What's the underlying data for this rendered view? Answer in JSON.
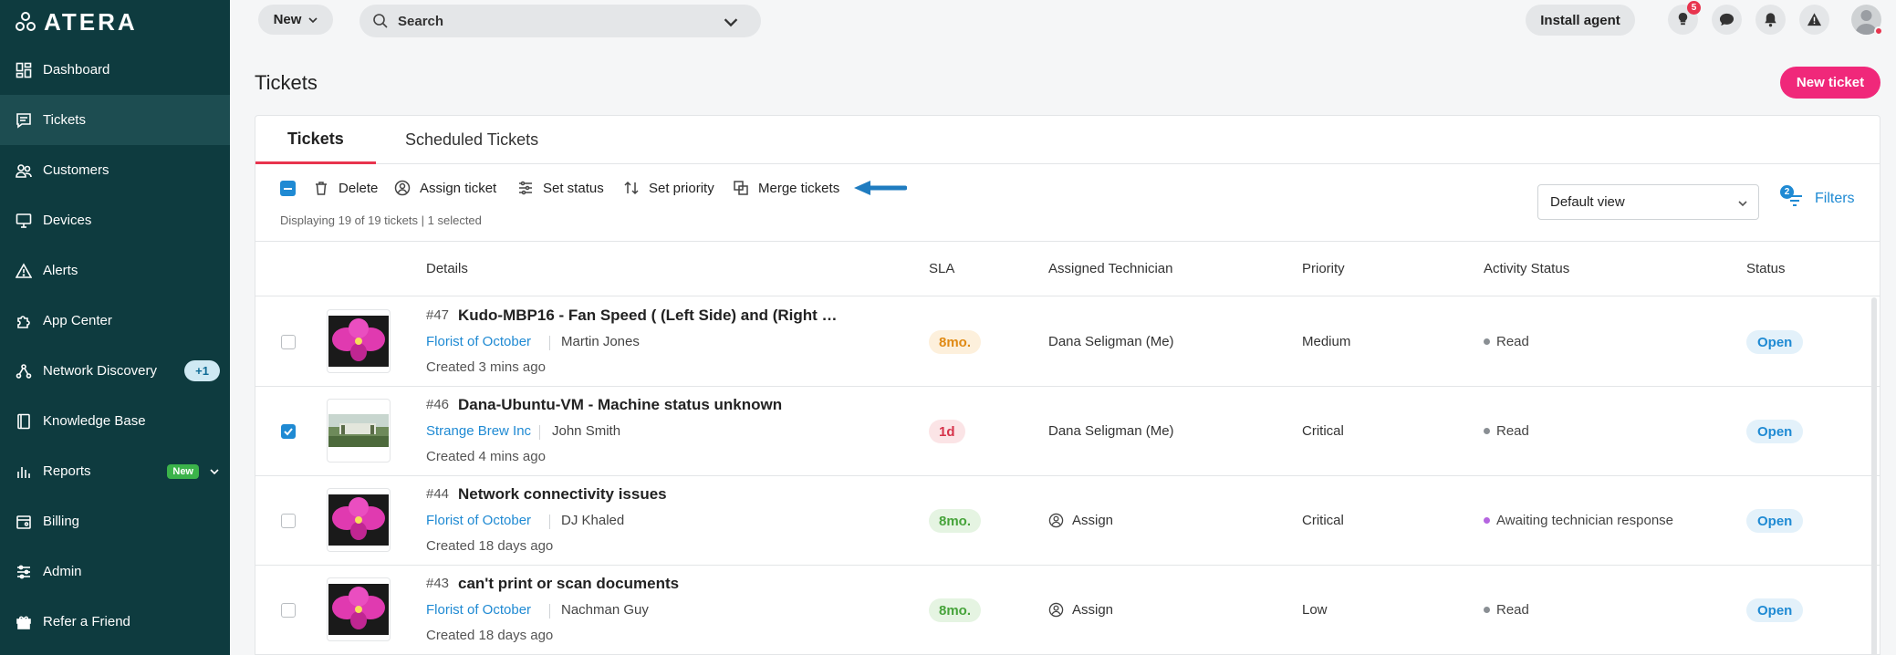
{
  "app": {
    "logo_text": "ATERA"
  },
  "sidebar": {
    "items": [
      {
        "label": "Dashboard",
        "icon": "dashboard-icon"
      },
      {
        "label": "Tickets",
        "icon": "tickets-icon",
        "active": true
      },
      {
        "label": "Customers",
        "icon": "customers-icon"
      },
      {
        "label": "Devices",
        "icon": "devices-icon"
      },
      {
        "label": "Alerts",
        "icon": "alerts-icon"
      },
      {
        "label": "App Center",
        "icon": "app-center-icon"
      },
      {
        "label": "Network Discovery",
        "icon": "network-discovery-icon",
        "count": "+1"
      },
      {
        "label": "Knowledge Base",
        "icon": "knowledge-base-icon"
      },
      {
        "label": "Reports",
        "icon": "reports-icon",
        "tag": "New"
      },
      {
        "label": "Billing",
        "icon": "billing-icon"
      },
      {
        "label": "Admin",
        "icon": "admin-icon"
      },
      {
        "label": "Refer a Friend",
        "icon": "gift-icon"
      }
    ]
  },
  "topbar": {
    "new_label": "New",
    "search_placeholder": "Search",
    "install_agent_label": "Install agent",
    "notification_badge": "5"
  },
  "page": {
    "title": "Tickets",
    "new_ticket_label": "New ticket"
  },
  "tabs": [
    {
      "label": "Tickets",
      "active": true
    },
    {
      "label": "Scheduled Tickets"
    }
  ],
  "toolbar": {
    "delete_label": "Delete",
    "assign_label": "Assign ticket",
    "set_status_label": "Set status",
    "set_priority_label": "Set priority",
    "merge_label": "Merge tickets",
    "display_count": "Displaying 19 of 19 tickets | 1 selected",
    "view_select": "Default view",
    "filters_label": "Filters",
    "filters_count": "2"
  },
  "table": {
    "columns": [
      "Details",
      "SLA",
      "Assigned Technician",
      "Priority",
      "Activity Status",
      "Status"
    ],
    "rows": [
      {
        "number": "#47",
        "title": "Kudo-MBP16 - Fan Speed ( (Left Side) and (Right …",
        "customer": "Florist of October",
        "contact": "Martin Jones",
        "created": "Created 3 mins ago",
        "sla": "8mo.",
        "sla_color": "orange",
        "technician": "Dana Seligman (Me)",
        "priority": "Medium",
        "activity": "Read",
        "activity_dot": "#8a8f94",
        "status": "Open",
        "checked": false,
        "thumb": "orchid"
      },
      {
        "number": "#46",
        "title": "Dana-Ubuntu-VM - Machine status unknown",
        "customer": "Strange Brew Inc",
        "contact": "John Smith",
        "created": "Created 4 mins ago",
        "sla": "1d",
        "sla_color": "red",
        "technician": "Dana Seligman (Me)",
        "priority": "Critical",
        "activity": "Read",
        "activity_dot": "#8a8f94",
        "status": "Open",
        "checked": true,
        "thumb": "landscape"
      },
      {
        "number": "#44",
        "title": "Network connectivity issues",
        "customer": "Florist of October",
        "contact": "DJ Khaled",
        "created": "Created 18 days ago",
        "sla": "8mo.",
        "sla_color": "green",
        "technician": "Assign",
        "priority": "Critical",
        "activity": "Awaiting technician response",
        "activity_dot": "#b565e0",
        "status": "Open",
        "checked": false,
        "thumb": "orchid"
      },
      {
        "number": "#43",
        "title": "can't print or scan documents",
        "customer": "Florist of October",
        "contact": "Nachman Guy",
        "created": "Created 18 days ago",
        "sla": "8mo.",
        "sla_color": "green",
        "technician": "Assign",
        "priority": "Low",
        "activity": "Read",
        "activity_dot": "#8a8f94",
        "status": "Open",
        "checked": false,
        "thumb": "orchid"
      }
    ]
  },
  "colors": {
    "sidebar_bg": "#0e3b3f",
    "accent_pink": "#f0287a",
    "link_blue": "#1f8ad3",
    "tab_underline": "#e8344e"
  }
}
